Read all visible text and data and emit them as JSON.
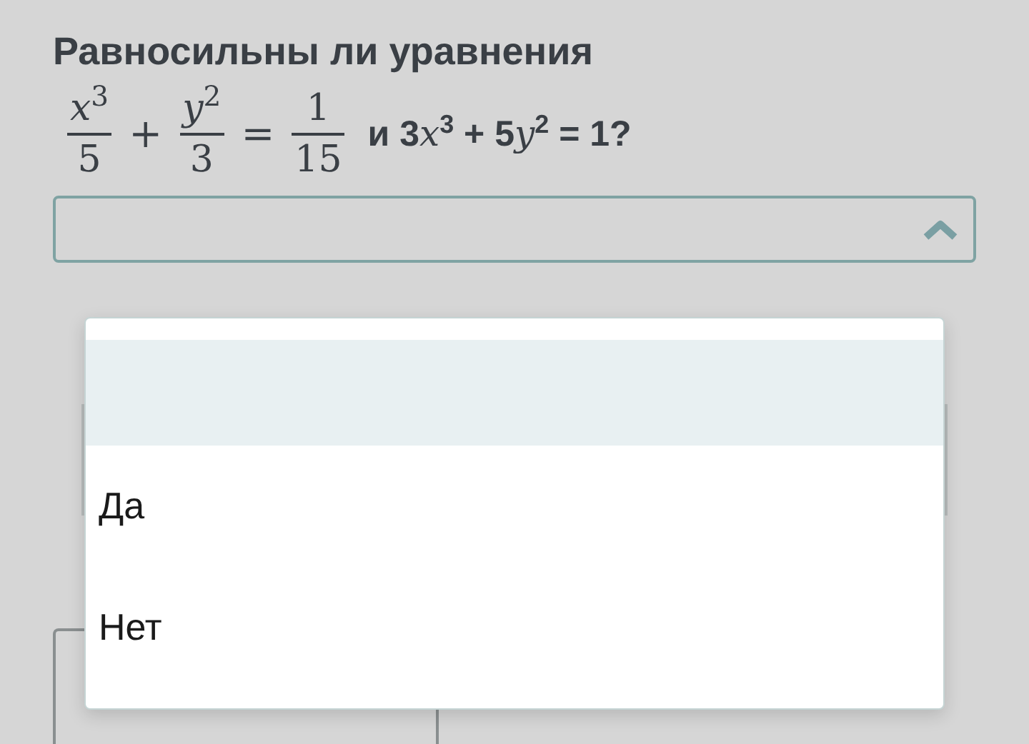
{
  "question": {
    "title": "Равносильны ли уравнения",
    "terms": [
      {
        "kind": "fraction",
        "numerator": "*x*$^{3}$",
        "denominator": "5"
      },
      {
        "kind": "operator",
        "text": "+"
      },
      {
        "kind": "fraction",
        "numerator": "*y*$^{2}$",
        "denominator": "3"
      },
      {
        "kind": "operator",
        "text": "="
      },
      {
        "kind": "fraction",
        "numerator": "1",
        "denominator": "15"
      }
    ],
    "tail": [
      {
        "kind": "plain",
        "text": "и 3"
      },
      {
        "kind": "math",
        "text": "x"
      },
      {
        "kind": "sup",
        "text": "3"
      },
      {
        "kind": "plain",
        "text": " + 5"
      },
      {
        "kind": "math",
        "text": "y"
      },
      {
        "kind": "sup",
        "text": "2"
      },
      {
        "kind": "plain",
        "text": " = 1?"
      }
    ]
  },
  "dropdown": {
    "expanded": true,
    "options": [
      {
        "selected": true
      },
      {
        "label": "Да",
        "selected": false
      },
      {
        "label": "Нет",
        "selected": false
      }
    ]
  }
}
